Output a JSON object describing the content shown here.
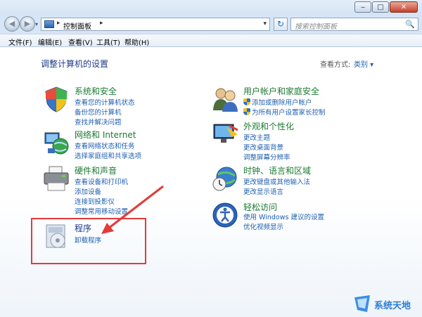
{
  "navbar": {
    "back_glyph": "◀",
    "forward_glyph": "▶",
    "history_glyph": "▾",
    "address_crumb": "控制面板",
    "address_arrow1": "▸",
    "address_arrow2": "▸",
    "address_dropdown": "▾",
    "refresh_glyph": "↻",
    "search_placeholder": "搜索控制面板",
    "search_glyph": "🔍"
  },
  "caption_buttons": {
    "minimize": "‒",
    "maximize": "□",
    "close": "✕"
  },
  "menubar": [
    "文件(F)",
    "编辑(E)",
    "查看(V)",
    "工具(T)",
    "帮助(H)"
  ],
  "main": {
    "heading": "调整计算机的设置",
    "view_label": "查看方式:",
    "view_value": "类别 ▾"
  },
  "categories": {
    "system": {
      "title": "系统和安全",
      "links": [
        "查看您的计算机状态",
        "备份您的计算机",
        "查找并解决问题"
      ],
      "icon": "shield-flag-icon"
    },
    "network": {
      "title": "网络和 Internet",
      "links": [
        "查看网络状态和任务",
        "选择家庭组和共享选项"
      ],
      "icon": "network-globe-icon"
    },
    "hardware": {
      "title": "硬件和声音",
      "links": [
        "查看设备和打印机",
        "添加设备",
        "连接到投影仪",
        "调整常用移动设置"
      ],
      "icon": "printer-icon"
    },
    "programs": {
      "title": "程序",
      "links": [
        "卸载程序"
      ],
      "icon": "programs-disc-icon"
    },
    "accounts": {
      "title": "用户帐户和家庭安全",
      "links": [
        "添加或删除用户帐户",
        "为所有用户设置家长控制"
      ],
      "icon": "users-icon"
    },
    "appearance": {
      "title": "外观和个性化",
      "links": [
        "更改主题",
        "更改桌面背景",
        "调整屏幕分辨率"
      ],
      "icon": "monitor-palette-icon"
    },
    "region": {
      "title": "时钟、语言和区域",
      "links": [
        "更改键盘或其他输入法",
        "更改显示语言"
      ],
      "icon": "clock-globe-icon"
    },
    "access": {
      "title": "轻松访问",
      "links": [
        "使用 Windows 建议的设置",
        "优化视频显示"
      ],
      "icon": "ease-of-access-icon"
    }
  },
  "watermark": {
    "text": "系统天地"
  },
  "colors": {
    "title_green": "#1b7a31",
    "link_blue": "#1f5fb0",
    "heading_blue": "#1e3a8a",
    "highlight_red": "#e23b3b"
  }
}
